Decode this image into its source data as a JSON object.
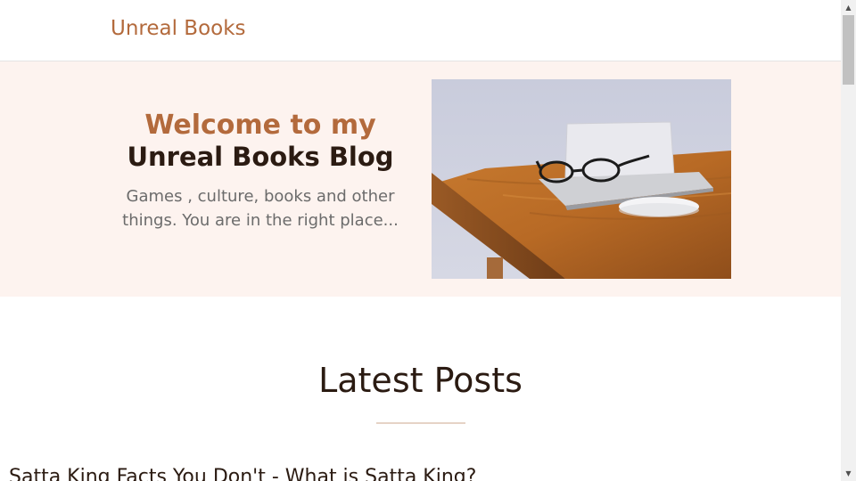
{
  "header": {
    "site_title": "Unreal Books"
  },
  "hero": {
    "line1": "Welcome to my",
    "line2": "Unreal Books Blog",
    "subtitle": "Games , culture, books and other things. You are in the right place...",
    "image_icon": "desk-laptop-glasses-photo"
  },
  "latest": {
    "title": "Latest Posts",
    "post_peek": "Satta King Facts You Don't - What is Satta King?"
  },
  "scrollbar": {
    "up_icon": "▲",
    "down_icon": "▼"
  },
  "colors": {
    "accent": "#b36a3c",
    "dark_text": "#2b1b12",
    "hero_bg": "#fdf3ef"
  }
}
